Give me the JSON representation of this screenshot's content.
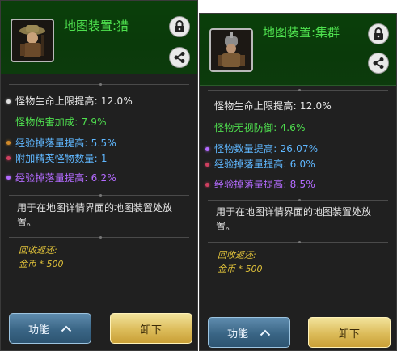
{
  "left": {
    "title": "地图装置:猎",
    "stats": [
      {
        "text": "怪物生命上限提高: 12.0%",
        "color": "#e8e8e8",
        "bullet": "#e0e0e0"
      },
      {
        "text": "怪物伤害加成: 7.9%",
        "color": "#4fe04f",
        "bullet": ""
      },
      {
        "text": "经验掉落量提高: 5.5%",
        "color": "#5fb7ff",
        "bullet": "#d08a2a"
      },
      {
        "text": "附加精英怪物数量: 1",
        "color": "#5fb7ff",
        "bullet": "#d04060"
      },
      {
        "text": "经验掉落量提高: 6.2%",
        "color": "#b46bff",
        "bullet": "#b46bff"
      }
    ],
    "description": "用于在地图详情界面的地图装置处放置。",
    "recycle_label": "回收返还:",
    "recycle_value": "金币 * 500",
    "function_button": "功能",
    "unload_button": "卸下"
  },
  "right": {
    "title": "地图装置:集群",
    "stats": [
      {
        "text": "怪物生命上限提高: 12.0%",
        "color": "#e8e8e8",
        "bullet": ""
      },
      {
        "text": "怪物无视防御: 4.6%",
        "color": "#4fe04f",
        "bullet": ""
      },
      {
        "text": "怪物数量提高: 26.07%",
        "color": "#5fb7ff",
        "bullet": "#b46bff"
      },
      {
        "text": "经验掉落量提高: 6.0%",
        "color": "#5fb7ff",
        "bullet": "#d04060"
      },
      {
        "text": "经验掉落量提高: 8.5%",
        "color": "#b46bff",
        "bullet": "#d04060"
      }
    ],
    "description": "用于在地图详情界面的地图装置处放置。",
    "recycle_label": "回收返还:",
    "recycle_value": "金币 * 500",
    "function_button": "功能",
    "unload_button": "卸下"
  },
  "icons": {
    "lock": "lock-icon",
    "share": "share-icon",
    "chevron": "chevron-up-icon",
    "portrait": "hunter-portrait"
  }
}
